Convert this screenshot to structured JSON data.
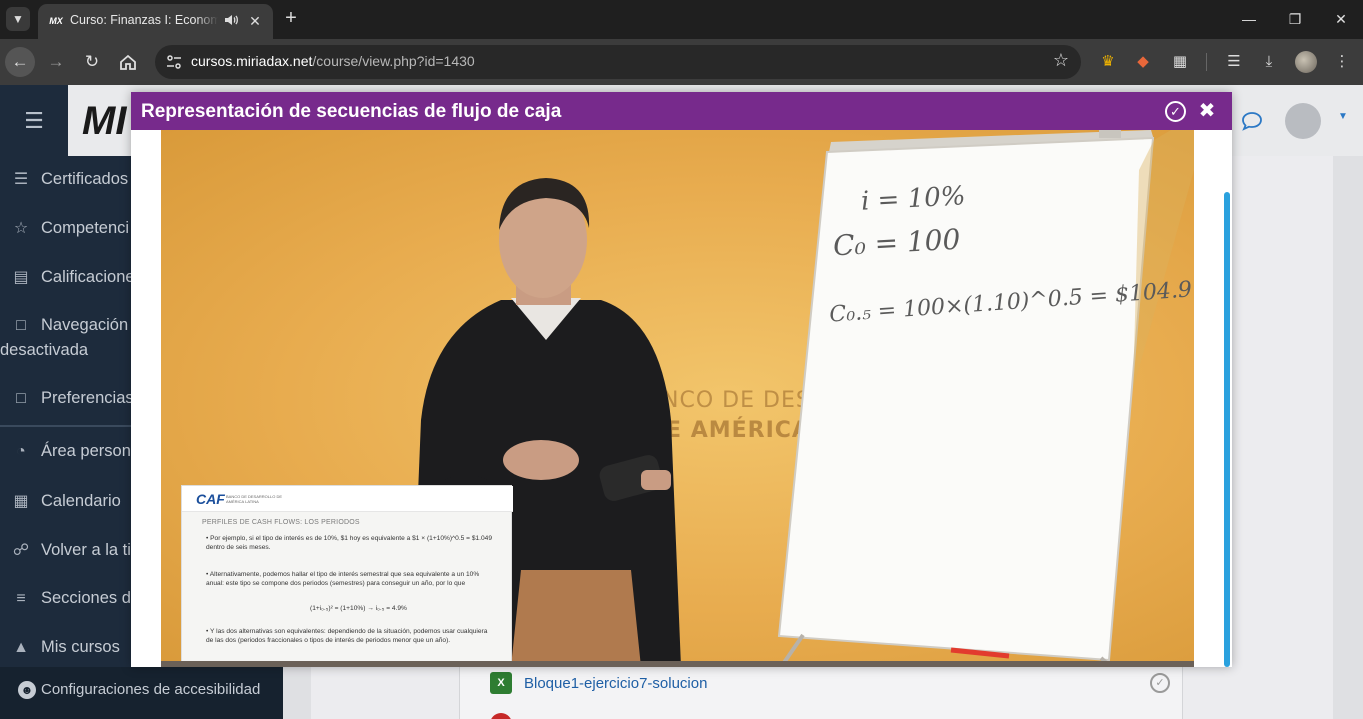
{
  "browser": {
    "tab": {
      "favicon": "MX",
      "title": "Curso: Finanzas I: Economía"
    },
    "url": {
      "host": "cursos.miriadax.net",
      "path": "/course/view.php?id=1430"
    }
  },
  "site": {
    "logo_text": "MI",
    "sidebar": {
      "items": [
        {
          "label": "Certificados",
          "icon": "layers-icon"
        },
        {
          "label": "Competenci",
          "icon": "star-icon"
        },
        {
          "label": "Calificacione",
          "icon": "book-icon"
        },
        {
          "label": "Navegación",
          "label2": "desactivada",
          "icon": "folder-icon"
        },
        {
          "label": "Preferencias",
          "icon": "folder-icon"
        },
        {
          "label": "Área persona",
          "icon": "dashboard-icon"
        },
        {
          "label": "Calendario",
          "icon": "calendar-icon"
        },
        {
          "label": "Volver a la ti",
          "icon": "cart-icon"
        },
        {
          "label": "Secciones d",
          "icon": "list-icon"
        },
        {
          "label": "Mis cursos",
          "icon": "graduation-cap-icon"
        }
      ],
      "footer": "Configuraciones de accesibilidad"
    },
    "activity": {
      "icon_text": "X",
      "link": "Bloque1-ejercicio7-solucion"
    }
  },
  "modal": {
    "title": "Representación de secuencias de flujo de caja",
    "video": {
      "watermark_line1": "ANCO DE DESARROLLO",
      "watermark_line2": "E AMÉRICA LATINA",
      "whiteboard": {
        "line1": "i = 10%",
        "line2": "C₀ = 100",
        "line3": "C₀.₅ = 100×(1.10)^0.5 = $104.9"
      },
      "slide": {
        "logo": "CAF",
        "logo_sub": "BANCO DE DESARROLLO DE AMÉRICA LATINA",
        "heading": "PERFILES DE CASH FLOWS: LOS PERIODOS",
        "bullet1": "Por ejemplo, si el tipo de interés es de 10%, $1 hoy es equivalente a $1 × (1+10%)^0.5 = $1.049 dentro de seis meses.",
        "bullet2": "Alternativamente, podemos hallar el tipo de interés semestral que sea equivalente a un 10% anual: este tipo se compone dos periodos (semestres) para conseguir un año, por lo que",
        "formula": "(1+i₀.₅)² = (1+10%) → i₀.₅ = 4.9%",
        "bullet3": "Y las dos alternativas son equivalentes: dependiendo de la situación, podemos usar cualquiera de las dos (periodos fraccionales o tipos de interés de periodos menor que un año)."
      }
    }
  }
}
